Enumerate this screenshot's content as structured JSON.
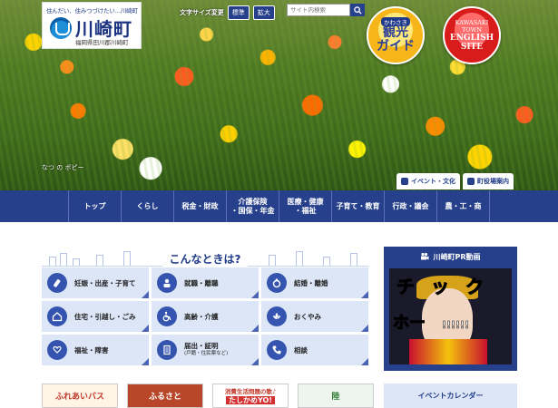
{
  "header": {
    "tagline": "住んだい、住みつづけたい…川崎町",
    "town_name": "川崎町",
    "address": "福岡県田川郡川崎町",
    "font_size_label": "文字サイズ変更",
    "font_size_standard": "標準",
    "font_size_large": "拡大",
    "search_placeholder": "サイト内検索"
  },
  "hero": {
    "tour_badge_small": "かわさき",
    "tour_badge_big": "観光\nガイド",
    "english_badge_line1": "KAWASAKI\nTOWN",
    "english_badge_line2": "ENGLISH\nSITE",
    "caption": "なつ の ポピー",
    "chip_event": "イベント・文化",
    "chip_office": "町役場案内"
  },
  "nav": [
    "トップ",
    "くらし",
    "税金・財政",
    "介護保険\n・国保・年金",
    "医療・健康\n・福祉",
    "子育て・教育",
    "行政・議会",
    "農・工・商"
  ],
  "section_title": "こんなときは?",
  "situations": [
    {
      "label": "妊娠・出産・子育て",
      "icon": "baby-bottle-icon"
    },
    {
      "label": "就職・離職",
      "icon": "worker-icon"
    },
    {
      "label": "結婚・離婚",
      "icon": "ring-icon"
    },
    {
      "label": "住宅・引越し・ごみ",
      "icon": "house-icon"
    },
    {
      "label": "高齢・介護",
      "icon": "wheelchair-icon"
    },
    {
      "label": "おくやみ",
      "icon": "flower-icon"
    },
    {
      "label": "福祉・障害",
      "icon": "heart-hand-icon"
    },
    {
      "label": "届出・証明",
      "sub": "(戸籍・住民票など)",
      "icon": "document-icon"
    },
    {
      "label": "相談",
      "icon": "phone-icon"
    }
  ],
  "pr_video": {
    "title": "川崎町PR動画",
    "overlay_1": "チック",
    "overlay_2": "ホー",
    "overlay_3": "!!!!!!"
  },
  "banners": [
    {
      "label": "ふれあいバス"
    },
    {
      "label": "ふるさと"
    },
    {
      "label_top": "消費生活問題の歌♪",
      "label_bottom": "たしかめYO!"
    },
    {
      "label": "陸"
    }
  ],
  "event_calendar": "イベントカレンダー"
}
